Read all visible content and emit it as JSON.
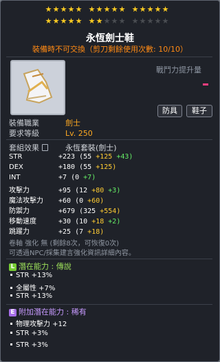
{
  "item_name": "永恆劍士鞋",
  "warning": "裝備時不可交換（剪刀剩餘使用次數: 10/10）",
  "power_label": "戰鬥力提升量",
  "tags": [
    "防具",
    "鞋子"
  ],
  "info": {
    "job_label": "裝備職業",
    "job_value": "劍士",
    "level_label": "要求等級",
    "level_value": "Lv. 250",
    "set_label": "套組效果",
    "set_value": "永恆套裝(劍士)"
  },
  "stats": [
    {
      "k": "STR",
      "total": "+223",
      "base": "(55",
      "a": "+125",
      "b": "+43)"
    },
    {
      "k": "DEX",
      "total": "+180",
      "base": "(55",
      "a": "+125)",
      "b": ""
    },
    {
      "k": "INT",
      "total": "+7",
      "base": "(0",
      "a": "",
      "b": "+7)"
    },
    {
      "k": "攻擊力",
      "total": "+95",
      "base": "(12",
      "a": "+80",
      "b": "+3)"
    },
    {
      "k": "魔法攻擊力",
      "total": "+60",
      "base": "(0",
      "a": "+60)",
      "b": ""
    },
    {
      "k": "防禦力",
      "total": "+679",
      "base": "(325",
      "a": "+554)",
      "b": ""
    },
    {
      "k": "移動速度",
      "total": "+30",
      "base": "(10",
      "a": "+18",
      "b": "+2)"
    },
    {
      "k": "跳躍力",
      "total": "+25",
      "base": "(7",
      "a": "+18)",
      "b": ""
    }
  ],
  "scroll_note": "卷軸 強化 無 (剩餘8次，可恢復0次)",
  "npc_note": "可透過NPC/採集建言強化資訊詳細內容。",
  "potential": {
    "title": "潛在能力",
    "sep": ":",
    "grade": "傳說",
    "lines": [
      "STR +13%",
      "全屬性 +7%",
      "STR +13%"
    ]
  },
  "add_potential": {
    "title": "附加潛在能力",
    "sep": ":",
    "grade": "稀有",
    "lines": [
      "物理攻擊力 +12",
      "STR +3%",
      "STR +3%"
    ]
  },
  "star_count": {
    "filled": 22,
    "total": 25
  },
  "colors": {
    "legend": "#ffcc22",
    "add_badge": "#a76ee8",
    "pot_badge": "#77cc33",
    "power_dash": "#ff3d7f"
  }
}
